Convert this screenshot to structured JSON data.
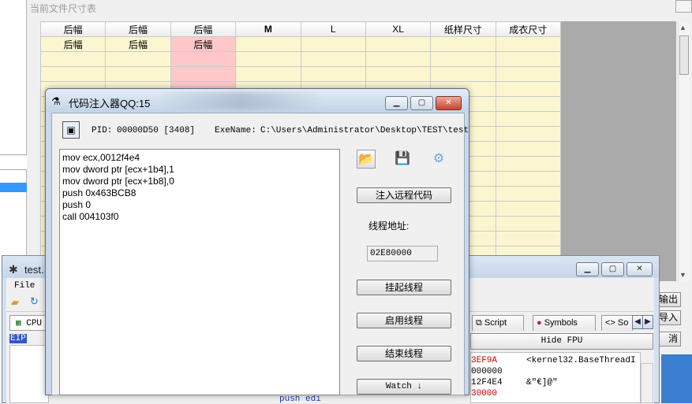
{
  "background": {
    "title": "当前文件尺寸表",
    "grid_headers": [
      "后幅",
      "后幅",
      "后幅",
      "M",
      "L",
      "XL",
      "纸样尺寸",
      "成衣尺寸"
    ],
    "grid_row1": [
      "后幅",
      "后幅",
      "后幅"
    ],
    "side_buttons": [
      "输出",
      "导入",
      "消"
    ]
  },
  "debugger": {
    "title": "test.",
    "menu_file": "File",
    "cpu_tab": "CPU",
    "eip_label": "EIP",
    "tabs": [
      "Script",
      "Symbols",
      "So"
    ],
    "hide_fpu": "Hide FPU",
    "registers": [
      {
        "value": "3EF9A",
        "comment": "<kernel32.BaseThreadI"
      },
      {
        "value": "000000",
        "comment": ""
      },
      {
        "value": "12F4E4",
        "comment": "&\"€]@\""
      },
      {
        "value": "30000",
        "comment": ""
      }
    ],
    "asm_fragment": "push edi"
  },
  "injector": {
    "title": "代码注入器QQ:15",
    "pid_label": "PID:",
    "pid_value": "00000D50 [3408]",
    "exe_label": "ExeName:",
    "exe_value": "C:\\Users\\Administrator\\Desktop\\TEST\\test",
    "code": "mov ecx,0012f4e4\nmov dword ptr [ecx+1b4],1\nmov dword ptr [ecx+1b8],0\npush 0x463BCB8\npush 0\ncall 004103f0",
    "inject_button": "注入远程代码",
    "thread_label": "线程地址:",
    "thread_address": "02E80000",
    "suspend_button": "挂起线程",
    "resume_button": "启用线程",
    "end_button": "结束线程",
    "watch_button": "Watch ↓"
  }
}
